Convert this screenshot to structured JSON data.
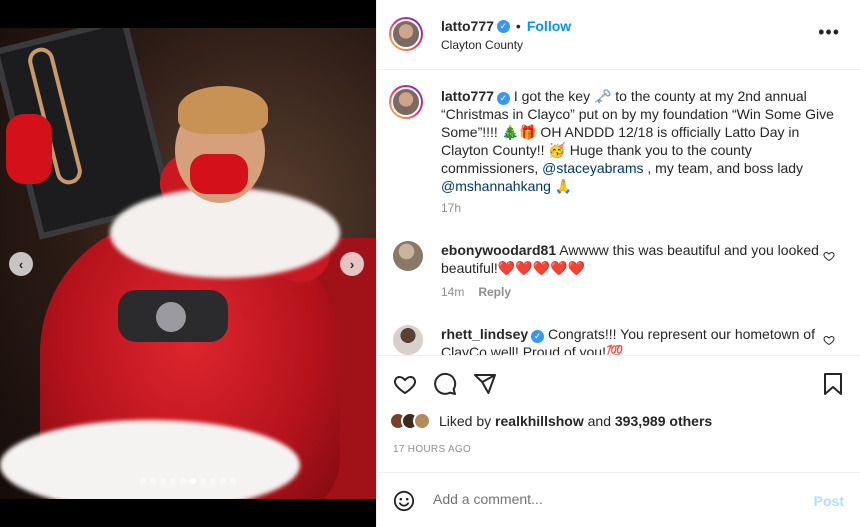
{
  "post": {
    "username": "latto777",
    "follow_label": "Follow",
    "separator": "•",
    "location": "Clayton County",
    "more_label": "•••"
  },
  "caption": {
    "username": "latto777",
    "part1": "I got the key 🗝️ to the county at my 2nd annual “Christmas in Clayco” put on by my foundation “Win Some Give Some”!!!! 🎄🎁 OH ANDDD 12/18 is officially Latto Day in Clayton County!! 🥳 Huge thank you to the county commissioners, ",
    "mention1": "@staceyabrams",
    "part2": " , my team, and boss lady ",
    "mention2": "@mshannahkang",
    "part3": " 🙏",
    "time": "17h"
  },
  "comments": [
    {
      "username": "ebonywoodard81",
      "text": "Awwww this was beautiful and you looked beautiful!❤️❤️❤️❤️❤️",
      "time": "14m",
      "reply_label": "Reply"
    },
    {
      "username": "rhett_lindsey",
      "text": "Congrats!!! You represent our hometown of ClayCo well! Proud of you!💯"
    }
  ],
  "likes": {
    "prefix": "Liked by ",
    "user": "realkhillshow",
    "middle": " and ",
    "count": "393,989 others"
  },
  "timestamp": "17 HOURS AGO",
  "add_comment": {
    "placeholder": "Add a comment...",
    "post_label": "Post"
  },
  "carousel": {
    "prev_icon": "chevron-left-icon",
    "next_icon": "chevron-right-icon",
    "dot_count": 10,
    "active_dot": 5
  },
  "colors": {
    "accent": "#0095f6",
    "verified": "#3897f0",
    "mention": "#00376b",
    "muted": "#8e8e8e",
    "post_disabled": "#b2dffc"
  }
}
